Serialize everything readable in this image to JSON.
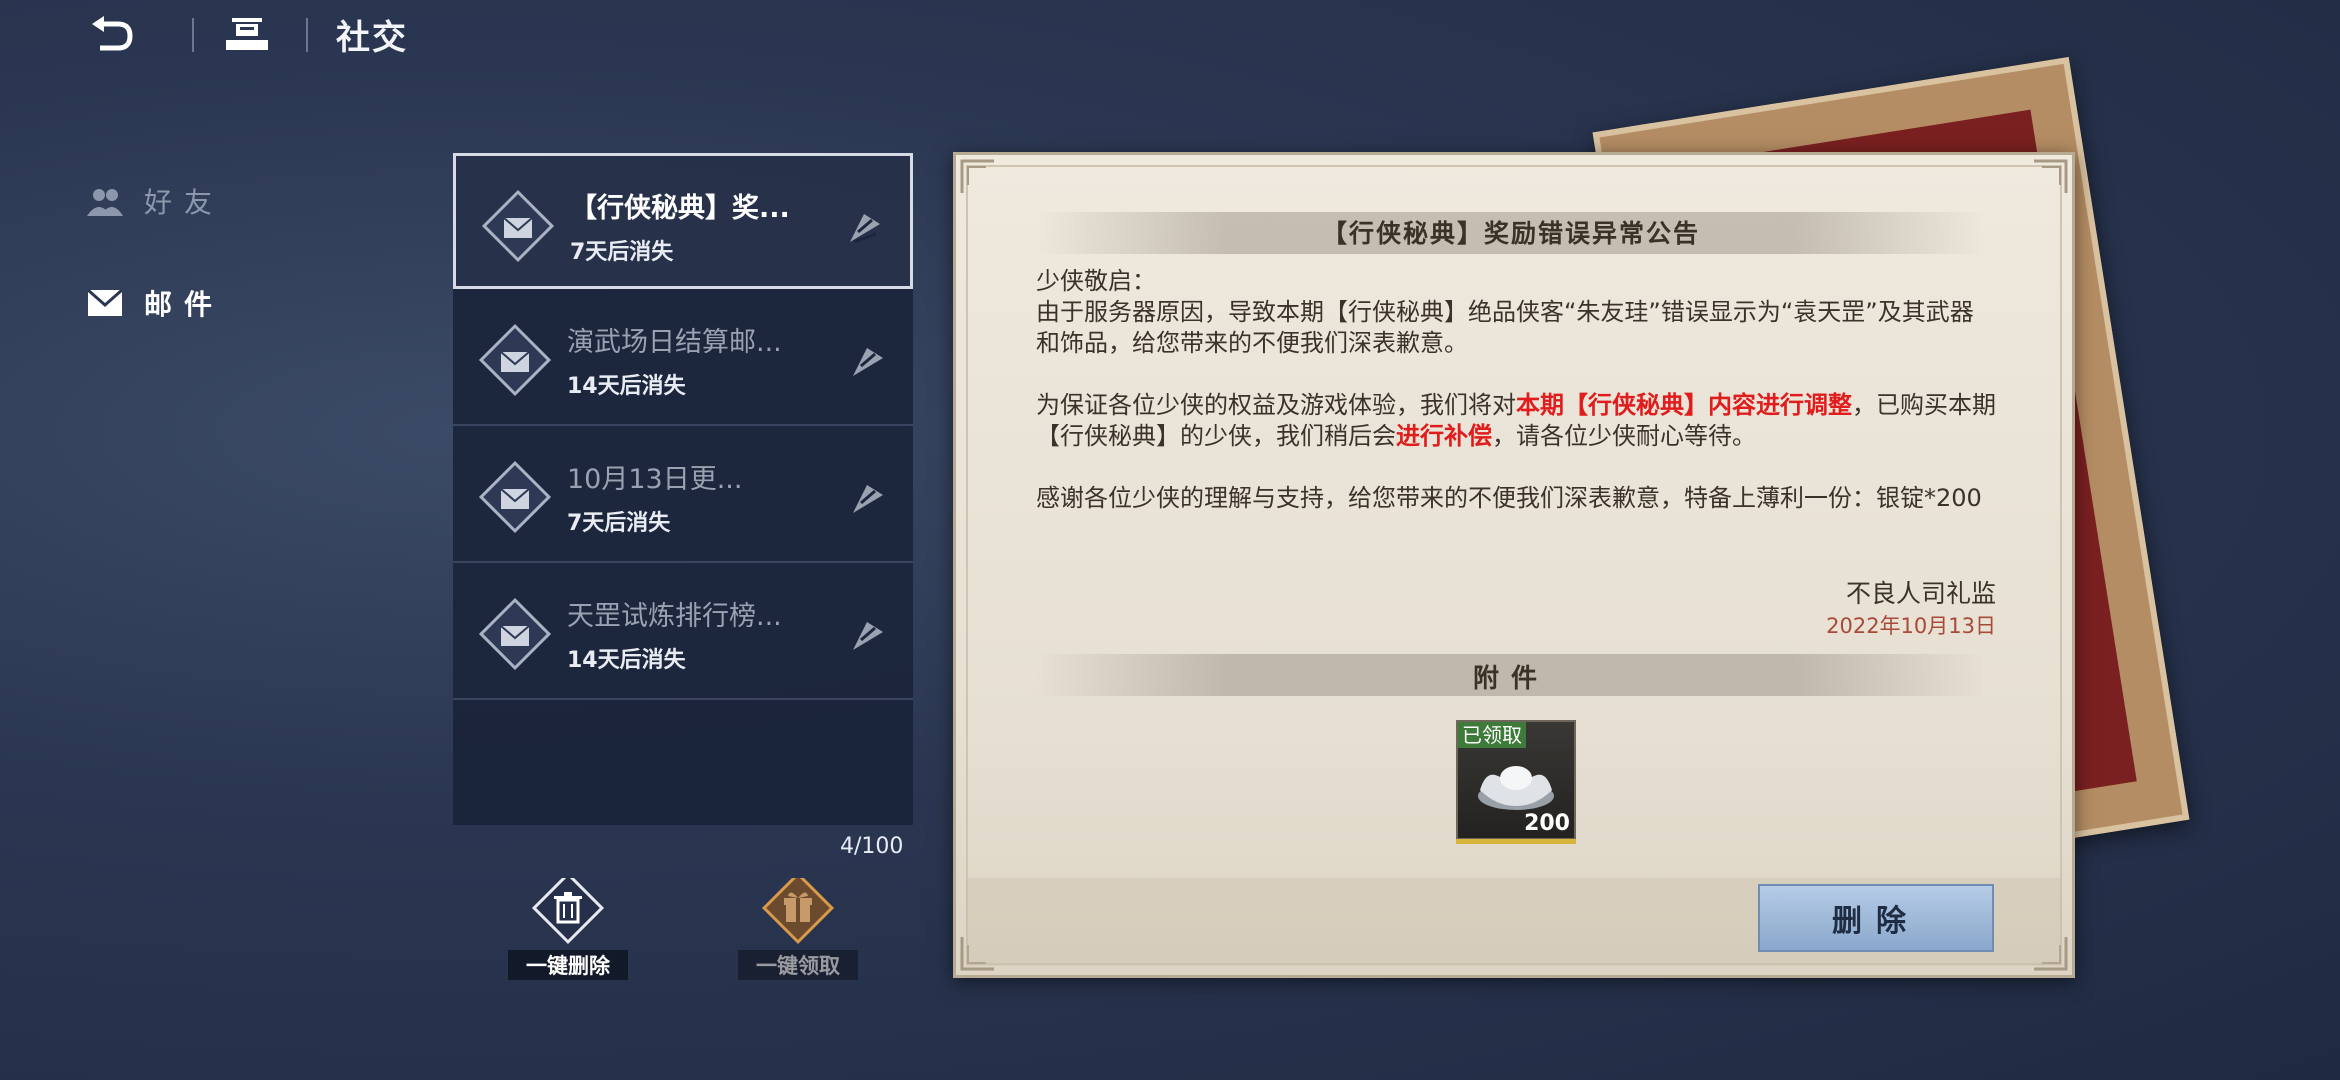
{
  "topbar": {
    "title": "社交",
    "back_icon": "back-arrow-icon",
    "home_icon": "home-icon"
  },
  "sidebar": {
    "items": [
      {
        "label": "好友",
        "icon": "friends-icon",
        "active": false
      },
      {
        "label": "邮件",
        "icon": "envelope-icon",
        "active": true
      }
    ]
  },
  "mail_list": {
    "items": [
      {
        "title": "【行侠秘典】奖...",
        "expiry": "7天后消失",
        "selected": true
      },
      {
        "title": "演武场日结算邮...",
        "expiry": "14天后消失",
        "selected": false
      },
      {
        "title": "10月13日更...",
        "expiry": "7天后消失",
        "selected": false
      },
      {
        "title": "天罡试炼排行榜...",
        "expiry": "14天后消失",
        "selected": false
      }
    ],
    "count": "4/100",
    "delete_all_label": "一键删除",
    "claim_all_label": "一键领取"
  },
  "notice": {
    "title": "【行侠秘典】奖励错误异常公告",
    "greeting": "少侠敬启：",
    "para1": "由于服务器原因，导致本期【行侠秘典】绝品侠客“朱友珪”错误显示为“袁天罡”及其武器和饰品，给您带来的不便我们深表歉意。",
    "para2_a": "为保证各位少侠的权益及游戏体验，我们将对",
    "para2_red1": "本期【行侠秘典】内容进行调整",
    "para2_b": "，已购买本期【行侠秘典】的少侠，我们稍后会",
    "para2_red2": "进行补偿",
    "para2_c": "，请各位少侠耐心等待。",
    "para3": "感谢各位少侠的理解与支持，给您带来的不便我们深表歉意，特备上薄利一份：银锭*200",
    "signer": "不良人司礼监",
    "date": "2022年10月13日"
  },
  "attachment": {
    "section_title": "附件",
    "claimed_label": "已领取",
    "quantity": "200",
    "item_icon": "silver-ingot-icon"
  },
  "actions": {
    "delete_label": "删除"
  },
  "colors": {
    "highlight_red": "#e01c1c",
    "date_color": "#a84a3a",
    "delete_button": "#9db6d9"
  }
}
